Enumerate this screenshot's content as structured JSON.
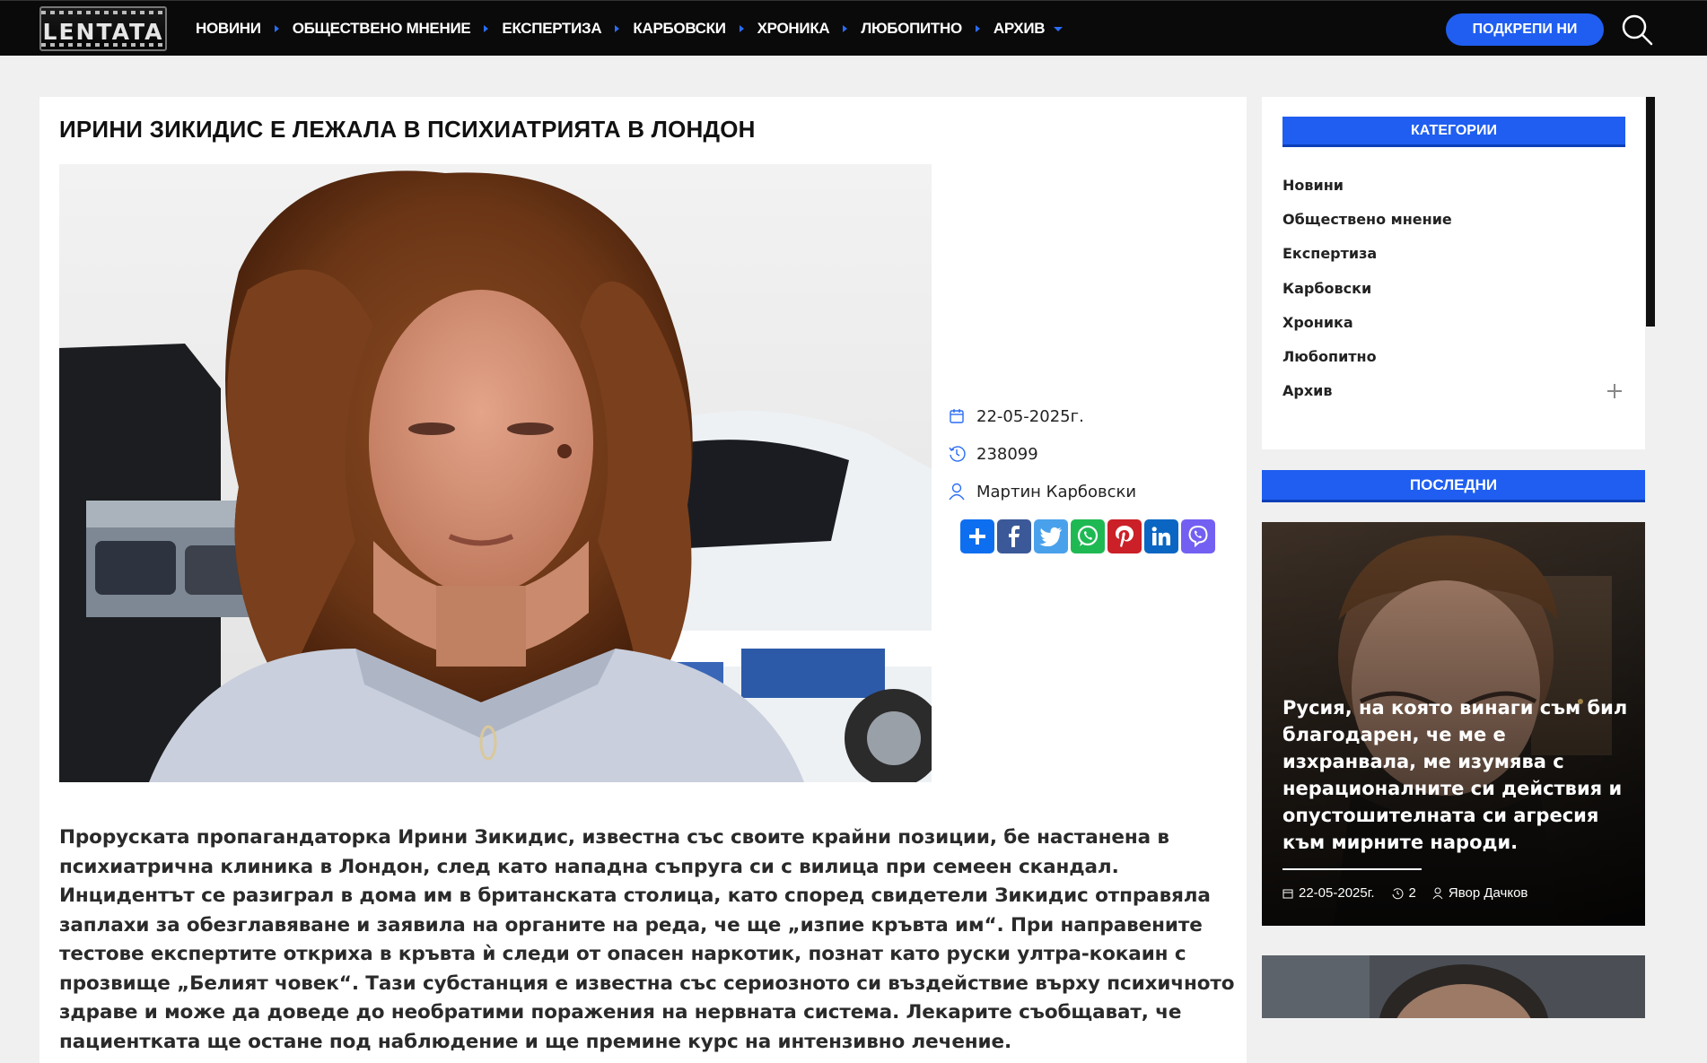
{
  "site": {
    "logo_text": "LENTATA"
  },
  "nav": {
    "items": [
      "НОВИНИ",
      "ОБЩЕСТВЕНО МНЕНИЕ",
      "ЕКСПЕРТИЗА",
      "КАРБОВСКИ",
      "ХРОНИКА",
      "ЛЮБОПИТНО",
      "АРХИВ"
    ],
    "support_label": "ПОДКРЕПИ НИ",
    "accent_color": "#1f5ef0"
  },
  "article": {
    "title": "ИРИНИ ЗИКИДИС Е ЛЕЖАЛА В ПСИХИАТРИЯТА В ЛОНДОН",
    "date": "22-05-2025г.",
    "views": "238099",
    "author": "Мартин Карбовски",
    "share_icons": [
      "add-share-icon",
      "facebook-icon",
      "twitter-icon",
      "whatsapp-icon",
      "pinterest-icon",
      "linkedin-icon",
      "viber-icon"
    ],
    "body": "Проруската пропагандаторка Ирини Зикидис, известна със своите крайни позиции, бе настанена в психиатрична клиника в Лондон, след като нападна съпруга си с вилица при семеен скандал. Инцидентът се разиграл в дома им в британската столица, като според свидетели Зикидис отправяла заплахи за обезглавяване и заявила на органите на реда, че ще „изпие кръвта им“. При направените тестове експертите откриха в кръвта ѝ следи от опасен наркотик, познат като руски ултра-кокаин с прозвище „Белият човек“. Тази субстанция е известна със сериозното си въздействие върху психичното здраве и може да доведе до необратими поражения на нервната система. Лекарите съобщават, че пациентката ще остане под наблюдение и ще премине курс на интензивно лечение."
  },
  "sidebar": {
    "categories_title": "КАТЕГОРИИ",
    "categories": [
      "Новини",
      "Обществено мнение",
      "Експертиза",
      "Карбовски",
      "Хроника",
      "Любопитно",
      "Архив"
    ],
    "latest_title": "ПОСЛЕДНИ",
    "latest": [
      {
        "title": "Русия, на която винаги съм бил благодарен, че ме е изхранвала, ме изумява с нерационалните си действия и опустошителната си агресия към мирните народи.",
        "date": "22-05-2025г.",
        "comments": "2",
        "author": "Явор Дачков"
      }
    ]
  }
}
